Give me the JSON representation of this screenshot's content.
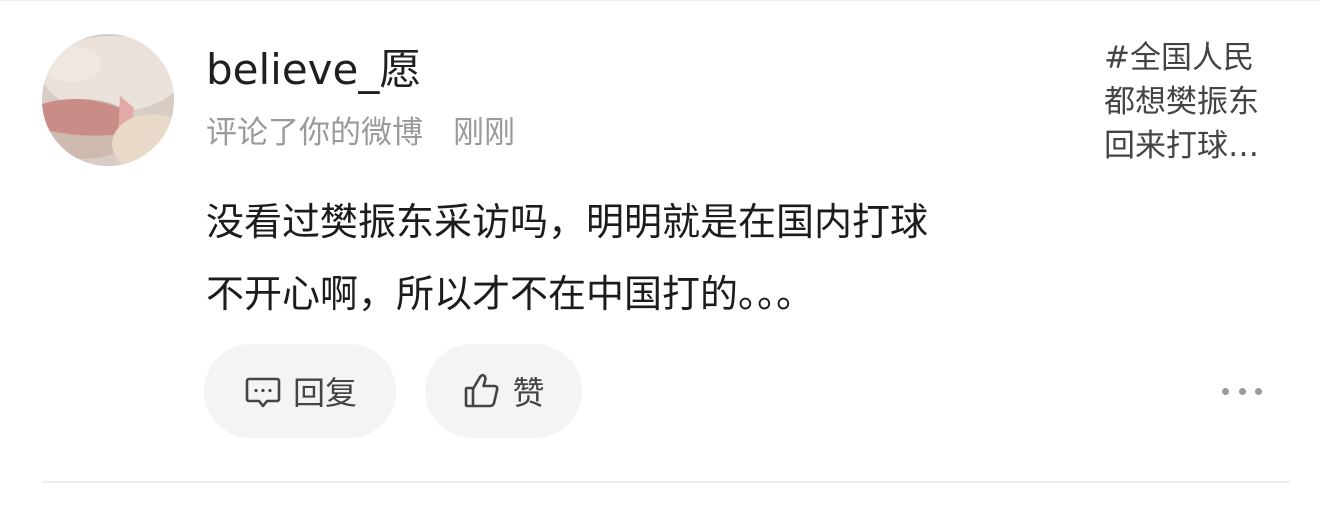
{
  "comment_card": {
    "username": "believe_愿",
    "action": "评论了你的微博",
    "time": "刚刚",
    "text_line1": "没看过樊振东采访吗，明明就是在国内打球",
    "text_line2": "不开心啊，所以才不在中国打的。。。",
    "topic_line1": "#全国人民",
    "topic_line2": "都想樊振东",
    "topic_line3": "回来打球…",
    "reply_label": "回复",
    "like_label": "赞"
  },
  "icons": {
    "reply": "comment-bubble-icon",
    "like": "thumbs-up-icon",
    "more": "more-dots-icon"
  },
  "colors": {
    "text_primary": "#1c1c1c",
    "text_secondary": "#9a9a9a",
    "pill_bg": "#f4f4f4"
  }
}
